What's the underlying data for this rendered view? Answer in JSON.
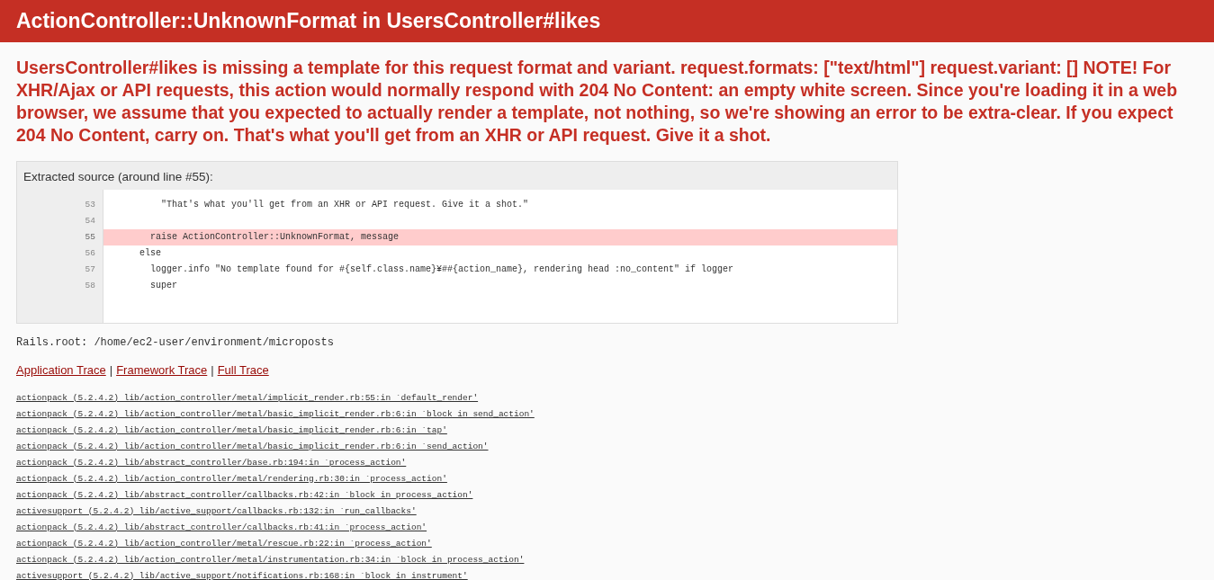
{
  "header": {
    "title": "ActionController::UnknownFormat in UsersController#likes"
  },
  "message": "UsersController#likes is missing a template for this request format and variant. request.formats: [\"text/html\"] request.variant: [] NOTE! For XHR/Ajax or API requests, this action would normally respond with 204 No Content: an empty white screen. Since you're loading it in a web browser, we assume that you expected to actually render a template, not nothing, so we're showing an error to be extra-clear. If you expect 204 No Content, carry on. That's what you'll get from an XHR or API request. Give it a shot.",
  "source": {
    "title": "Extracted source (around line #55):",
    "lines": [
      {
        "number": "53",
        "code": "          \"That's what you'll get from an XHR or API request. Give it a shot.\"",
        "highlighted": false
      },
      {
        "number": "54",
        "highlighted": false
      },
      {
        "number": "55",
        "code": "        raise ActionController::UnknownFormat, message",
        "highlighted": true
      },
      {
        "number": "56",
        "code": "      else",
        "highlighted": false
      },
      {
        "number": "57",
        "code": "        logger.info \"No template found for #{self.class.name}¥##{action_name}, rendering head :no_content\" if logger",
        "highlighted": false
      },
      {
        "number": "58",
        "code": "        super",
        "highlighted": false
      }
    ]
  },
  "rails_root": "Rails.root: /home/ec2-user/environment/microposts",
  "trace_links": [
    "Application Trace",
    "Framework Trace",
    "Full Trace"
  ],
  "trace_link_separator": "|",
  "trace": [
    "actionpack (5.2.4.2) lib/action_controller/metal/implicit_render.rb:55:in `default_render'",
    "actionpack (5.2.4.2) lib/action_controller/metal/basic_implicit_render.rb:6:in `block in send_action'",
    "actionpack (5.2.4.2) lib/action_controller/metal/basic_implicit_render.rb:6:in `tap'",
    "actionpack (5.2.4.2) lib/action_controller/metal/basic_implicit_render.rb:6:in `send_action'",
    "actionpack (5.2.4.2) lib/abstract_controller/base.rb:194:in `process_action'",
    "actionpack (5.2.4.2) lib/action_controller/metal/rendering.rb:30:in `process_action'",
    "actionpack (5.2.4.2) lib/abstract_controller/callbacks.rb:42:in `block in process_action'",
    "activesupport (5.2.4.2) lib/active_support/callbacks.rb:132:in `run_callbacks'",
    "actionpack (5.2.4.2) lib/abstract_controller/callbacks.rb:41:in `process_action'",
    "actionpack (5.2.4.2) lib/action_controller/metal/rescue.rb:22:in `process_action'",
    "actionpack (5.2.4.2) lib/action_controller/metal/instrumentation.rb:34:in `block in process_action'",
    "activesupport (5.2.4.2) lib/active_support/notifications.rb:168:in `block in instrument'"
  ]
}
